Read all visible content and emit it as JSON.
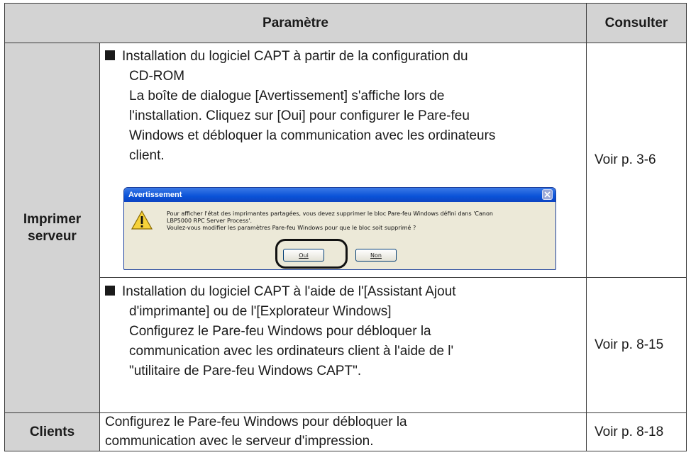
{
  "header": {
    "parametre": "Paramètre",
    "consulter": "Consulter"
  },
  "rows": {
    "server_label": "Imprimer\nserveur",
    "clients_label": "Clients",
    "server_a": {
      "lines": [
        "Installation du logiciel CAPT à partir de la configuration du",
        "CD-ROM",
        "La boîte de dialogue [Avertissement] s'affiche lors de",
        "l'installation. Cliquez sur [Oui] pour configurer le Pare-feu",
        "Windows et débloquer la communication avec les ordinateurs",
        "client."
      ],
      "ref": "Voir p. 3-6"
    },
    "server_b": {
      "lines": [
        "Installation du logiciel CAPT à l'aide de l'[Assistant Ajout",
        "d'imprimante] ou de l'[Explorateur Windows]",
        "Configurez le Pare-feu Windows pour débloquer la",
        "communication avec les ordinateurs client à l'aide de l'",
        "\"utilitaire de Pare-feu Windows CAPT\"."
      ],
      "ref": "Voir p. 8-15"
    },
    "clients": {
      "lines": [
        "Configurez le Pare-feu Windows pour débloquer la",
        "communication avec le serveur d'impression."
      ],
      "ref": "Voir p. 8-18"
    }
  },
  "dialog": {
    "title": "Avertissement",
    "message": [
      "Pour afficher l'état des imprimantes partagées, vous devez supprimer le bloc Pare-feu Windows défini dans 'Canon",
      "LBP5000 RPC Server Process'.",
      "Voulez-vous modifier les paramètres Pare-feu Windows pour que le bloc soit supprimé ?"
    ],
    "yes": "Oui",
    "no": "Non",
    "icon": "warning-icon"
  }
}
